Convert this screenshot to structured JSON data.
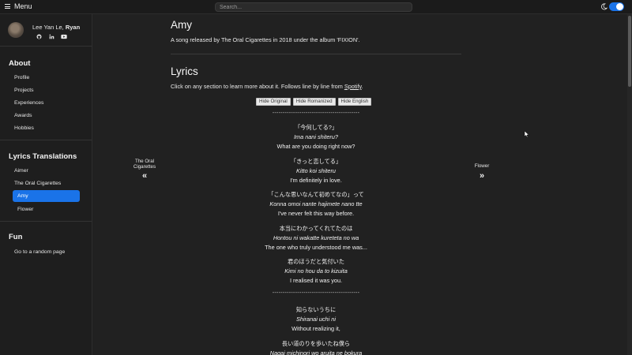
{
  "topbar": {
    "menu_label": "Menu",
    "search_placeholder": "Search...",
    "theme_icon": "moon-icon",
    "dark_mode_on": true,
    "accent": "#1a73e8"
  },
  "profile": {
    "name_prefix": "Lee Yan Le, ",
    "name_bold": "Ryan",
    "social": [
      "github-icon",
      "linkedin-icon",
      "youtube-icon"
    ]
  },
  "sidebar": {
    "about_title": "About",
    "about_items": [
      "Profile",
      "Projects",
      "Experiences",
      "Awards",
      "Hobbies"
    ],
    "lyrics_title": "Lyrics Translations",
    "lyrics_items": [
      "Aimer",
      "The Oral Cigarettes",
      "Amy",
      "Flower"
    ],
    "active_item": "Amy",
    "fun_title": "Fun",
    "fun_items": [
      "Go to a random page"
    ]
  },
  "main": {
    "title": "Amy",
    "description": "A song released by The Oral Cigarettes in 2018 under the album 'FIXION'.",
    "lyrics_heading": "Lyrics",
    "lyrics_desc_prefix": "Click on any section to learn more about it. Follows line by line from ",
    "lyrics_desc_link": "Spotify",
    "lyrics_desc_suffix": ".",
    "buttons": [
      "Hide Original",
      "Hide Romanized",
      "Hide English"
    ],
    "separator": "------------------------------------------",
    "prev_label_1": "The Oral",
    "prev_label_2": "Cigarettes",
    "prev_icon": "double-chevron-left-icon",
    "next_label": "Flower",
    "next_icon": "double-chevron-right-icon"
  },
  "lyrics": [
    {
      "jp": "「今何してる?」",
      "romaji": "Ima nani shiteru?",
      "en": "What are you doing right now?"
    },
    {
      "jp": "「きっと恋してる」",
      "romaji": "Kitto koi shiteru",
      "en": "I'm definitely in love."
    },
    {
      "jp": "「こんな思いなんて初めてなの」って",
      "romaji": "Konna omoi nante hajimete nano tte",
      "en": "I've never felt this way before."
    },
    {
      "jp": "本当にわかってくれてたのは",
      "romaji": "Hontou ni wakatte kureteta no wa",
      "en": "The one who truly understood me was..."
    },
    {
      "jp": "君のほうだと気付いた",
      "romaji": "Kimi no hou da to kizuita",
      "en": "I realised it was you."
    },
    {
      "jp": "知らないうちに",
      "romaji": "Shiranai uchi ni",
      "en": "Without realizing it,"
    },
    {
      "jp": "長い道のりを歩いたね僕ら",
      "romaji": "Nagai michinori wo aruita ne bokura",
      "en": ""
    }
  ]
}
